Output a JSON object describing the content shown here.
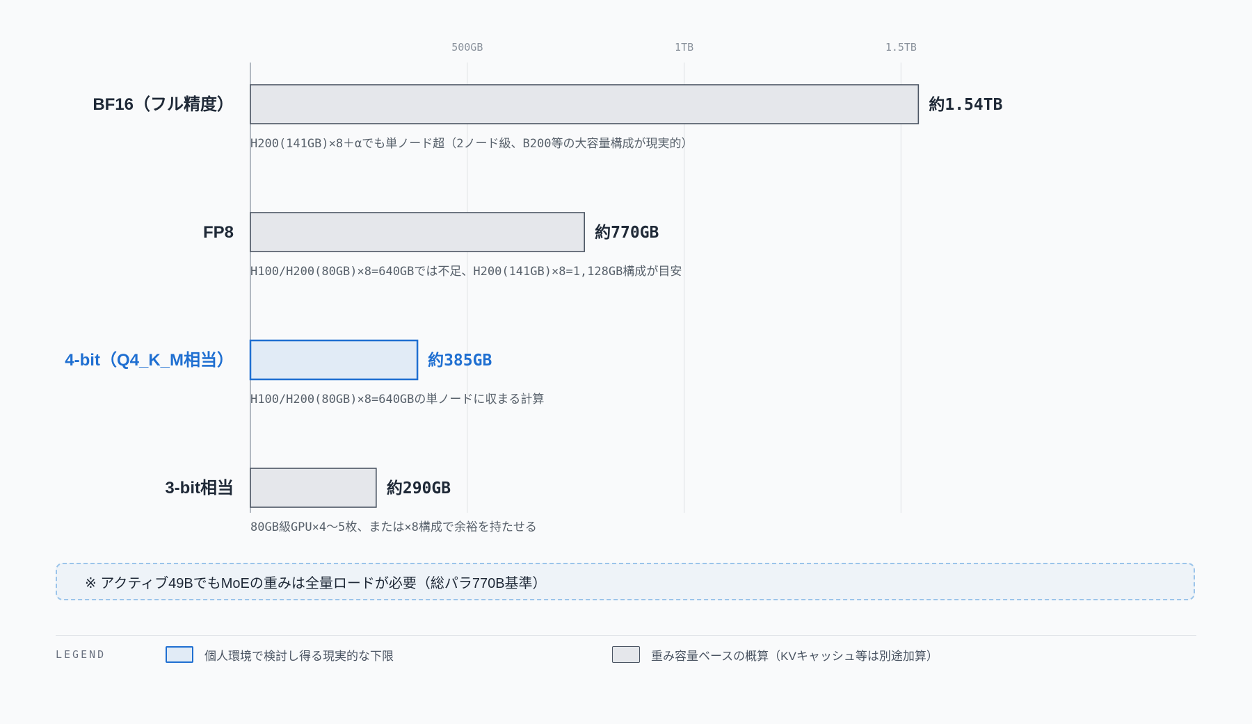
{
  "chart_data": {
    "type": "bar",
    "orientation": "horizontal",
    "unit": "GB",
    "xlim": [
      0,
      1800
    ],
    "ticks": [
      {
        "value": 500,
        "label": "500GB"
      },
      {
        "value": 1000,
        "label": "1TB"
      },
      {
        "value": 1500,
        "label": "1.5TB"
      }
    ],
    "grid": true,
    "categories": [
      "BF16（フル精度）",
      "FP8",
      "4-bit（Q4_K_M相当）",
      "3-bit相当"
    ],
    "values": [
      1540,
      770,
      385,
      290
    ],
    "value_labels": [
      "約1.54TB",
      "約770GB",
      "約385GB",
      "約290GB"
    ],
    "notes": [
      "H200(141GB)×8＋αでも単ノード超（2ノード級、B200等の大容量構成が現実的）",
      "H100/H200(80GB)×8=640GBでは不足、H200(141GB)×8=1,128GB構成が目安",
      "H100/H200(80GB)×8=640GBの単ノードに収まる計算",
      "80GB級GPU×4〜5枚、または×8構成で余裕を持たせる"
    ],
    "highlighted": [
      false,
      false,
      true,
      false
    ]
  },
  "callout": {
    "text": "※ アクティブ49BでもMoEの重みは全量ロードが必要（総パラ770B基準）"
  },
  "legend": {
    "title": "LEGEND",
    "items": [
      {
        "label": "個人環境で検討し得る現実的な下限",
        "style": "highlight"
      },
      {
        "label": "重み容量ベースの概算（KVキャッシュ等は別途加算）",
        "style": "base"
      }
    ]
  },
  "colors": {
    "highlight": "#1f6fd1",
    "highlight_fill": "#e1ebf6",
    "bar_fill": "#e5e7eb",
    "bar_stroke": "#4b5563",
    "text": "#1f2937",
    "grid": "#e3e5e8",
    "axis": "#9ca3af"
  }
}
